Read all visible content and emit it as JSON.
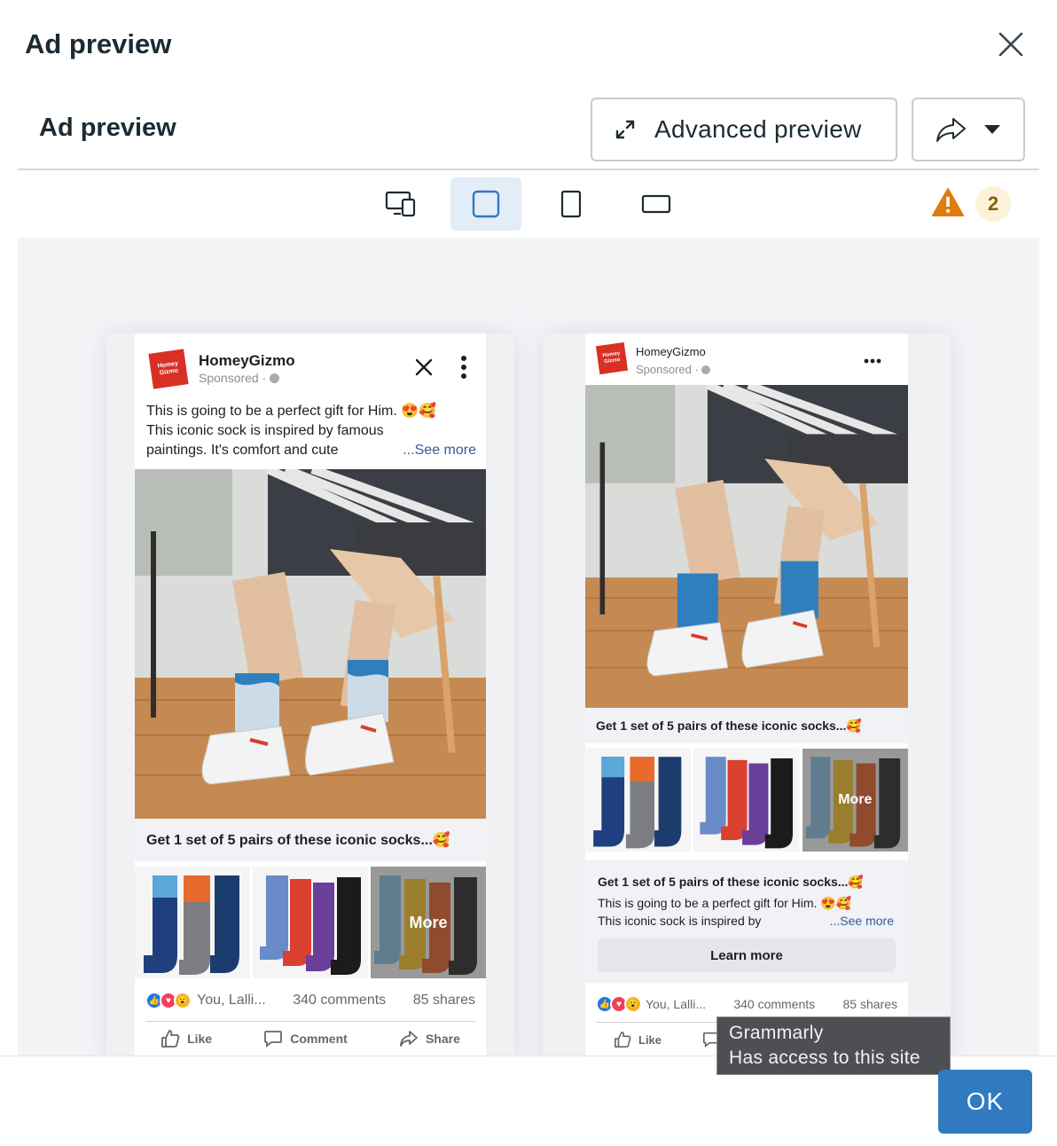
{
  "dialog": {
    "title": "Ad preview",
    "ok_label": "OK"
  },
  "header": {
    "section_title": "Ad preview",
    "advanced_preview_label": "Advanced preview"
  },
  "toolbar": {
    "warning_count": "2"
  },
  "left_card": {
    "page_name": "HomeyGizmo",
    "sponsored": "Sponsored · ",
    "post_text_1": "This is going to be a perfect gift for Him. 😍🥰",
    "post_text_2": "This iconic sock is inspired by famous",
    "post_text_3": "paintings. It's comfort and cute",
    "see_more": "...See more",
    "caption": "Get 1 set of 5 pairs of these iconic socks...🥰",
    "more_label": "More",
    "reactions_names": "You, Lalli...",
    "comments": "340 comments",
    "shares": "85 shares",
    "like": "Like",
    "comment": "Comment",
    "share": "Share"
  },
  "right_card": {
    "page_name": "HomeyGizmo",
    "sponsored": "Sponsored · ",
    "caption": "Get 1 set of 5 pairs of these iconic socks...🥰",
    "more_label": "More",
    "headline": "Get 1 set of 5 pairs of these iconic socks...🥰",
    "desc_1": "This is going to be a perfect gift for Him. 😍🥰",
    "desc_2": "This iconic sock is inspired by",
    "see_more": "...See more",
    "cta": "Learn more",
    "reactions_names": "You, Lalli...",
    "comments": "340 comments",
    "shares": "85 shares",
    "like": "Like"
  },
  "tooltip": {
    "line1": "Grammarly",
    "line2": "Has access to this site"
  },
  "colors": {
    "accent": "#2f7ac0",
    "warning": "#e07c0e",
    "link": "#385898"
  }
}
